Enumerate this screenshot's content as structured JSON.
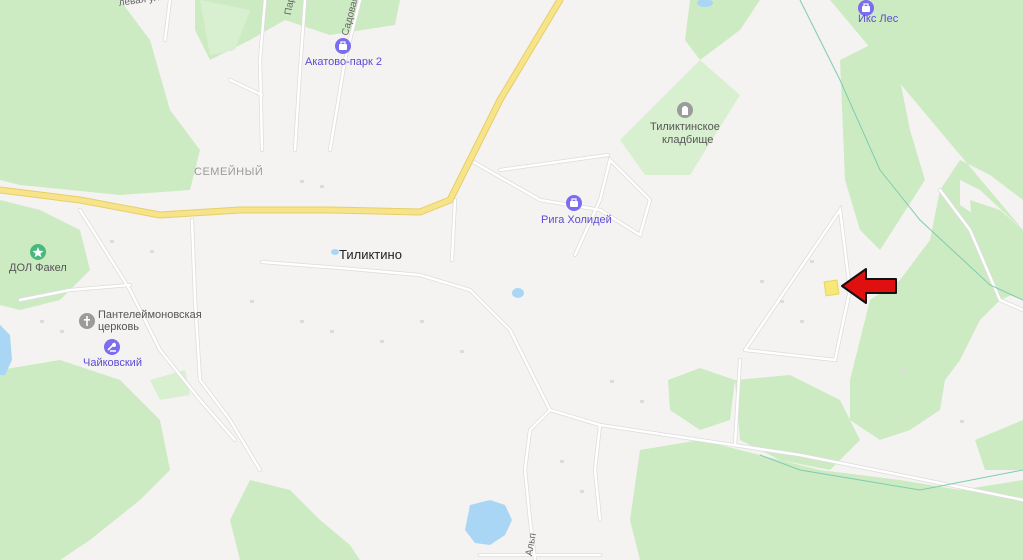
{
  "map": {
    "colors": {
      "background": "#f4f3f1",
      "forest": "#cdebc3",
      "forest_light": "#d8f0cf",
      "road_main": "#f7e38a",
      "road_main_edge": "#e6cf6a",
      "road_minor": "#ffffff",
      "road_minor_edge": "#dcdcdc",
      "water": "#a9d6f5",
      "poi_purple": "#7b6cf0",
      "poi_gray": "#9b9b9b",
      "poi_green": "#48b97a",
      "marker_red": "#e01010",
      "highlight_yellow": "#f6e97a"
    },
    "settlement": {
      "name": "Тиликтино"
    },
    "district": {
      "name": "СЕМЕЙНЫЙ"
    },
    "pois": {
      "akatovo": {
        "name": "Акатово-парк 2",
        "icon": "hotel-icon"
      },
      "iks_les": {
        "name": "Икс Лес",
        "icon": "hotel-icon"
      },
      "kladbishe": {
        "name_line1": "Тиликтинское",
        "name_line2": "кладбище",
        "icon": "cemetery-icon"
      },
      "riga": {
        "name": "Рига Холидей",
        "icon": "hotel-icon"
      },
      "dol": {
        "name": "ДОЛ Факел",
        "icon": "camp-icon"
      },
      "church": {
        "name_line1": "Пантелеймоновская",
        "name_line2": "церковь",
        "icon": "church-icon"
      },
      "chaikovsky": {
        "name": "Чайковский",
        "icon": "resort-icon"
      }
    },
    "streets": {
      "parkovaya": "Парковая",
      "sadovaya": "Садовая",
      "levaya": "левая ул.",
      "alp": "Альп"
    },
    "marker": {
      "icon": "arrow-left-icon"
    }
  }
}
